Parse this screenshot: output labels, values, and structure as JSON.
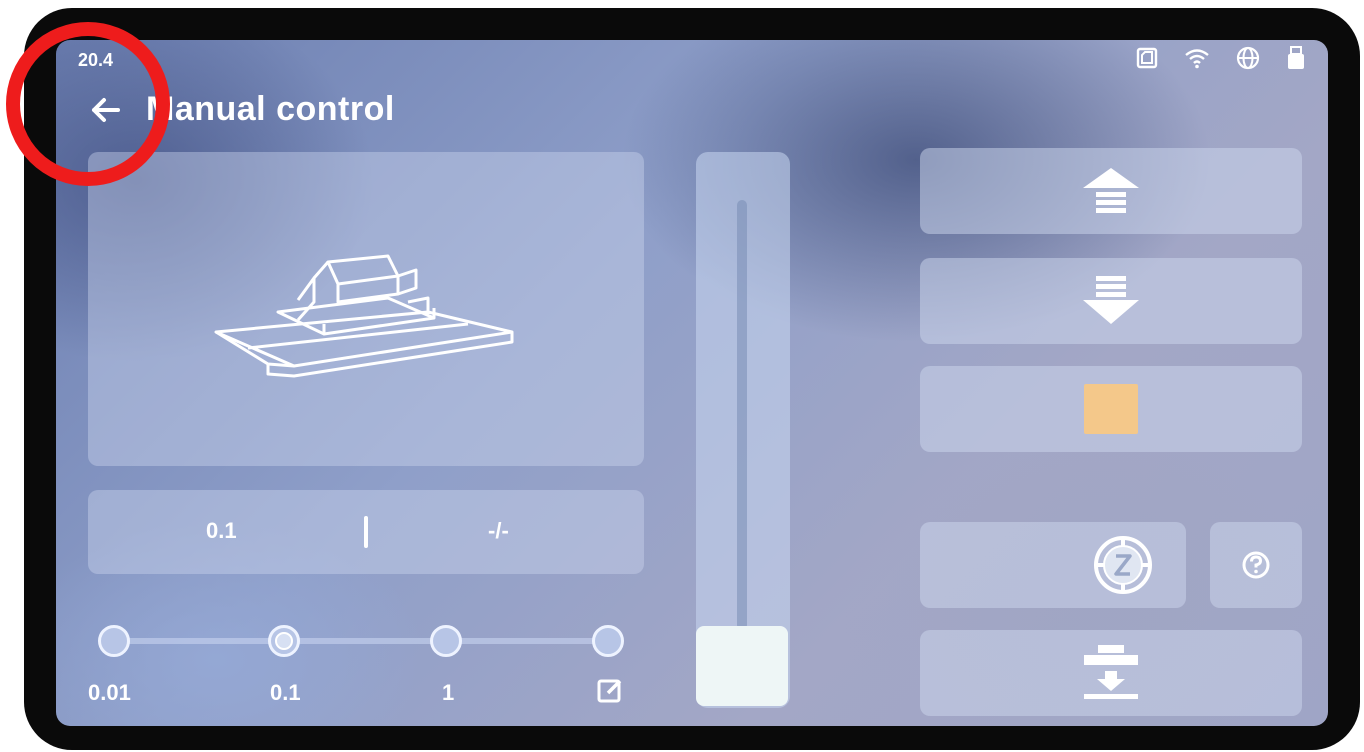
{
  "status_bar": {
    "time": "20.4",
    "icons": [
      "sd-card-icon",
      "wifi-icon",
      "globe-icon",
      "usb-drive-icon"
    ]
  },
  "header": {
    "title": "Manual control",
    "back_icon": "back-arrow-icon"
  },
  "readout": {
    "step_value": "0.1",
    "position_value": "-/-"
  },
  "step_selector": {
    "options": [
      "0.01",
      "0.1",
      "1"
    ],
    "custom_icon": "edit-icon",
    "selected": "0.1"
  },
  "z_slider": {
    "level": 0.0
  },
  "buttons": {
    "up_icon": "move-up-icon",
    "down_icon": "move-down-icon",
    "stop_icon": "stop-icon",
    "home_icon": "z-home-icon",
    "help_icon": "help-icon",
    "lower_icon": "lower-platform-icon"
  },
  "colors": {
    "stop": "#f4c88a",
    "highlight_circle": "#ee1c1c"
  }
}
